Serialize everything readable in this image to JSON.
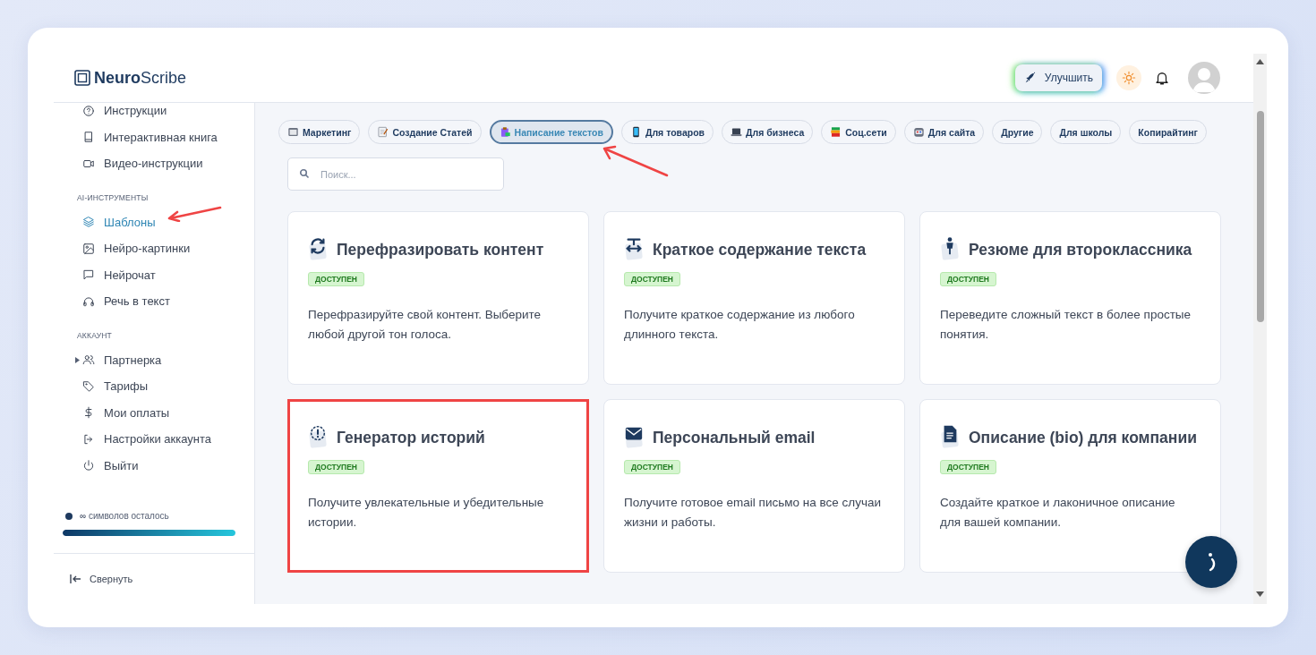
{
  "header": {
    "logo": {
      "bold": "Neuro",
      "light": "Scribe"
    },
    "upgrade_button": "Улучшить"
  },
  "sidebar": {
    "sections": [
      {
        "items": [
          {
            "label": "Инструкции",
            "kind": "help",
            "selected": false,
            "annotated": false
          },
          {
            "label": "Интерактивная книга",
            "kind": "book",
            "selected": false,
            "annotated": false
          },
          {
            "label": "Видео-инструкции",
            "kind": "video",
            "selected": false,
            "annotated": false
          }
        ]
      },
      {
        "title": "AI-ИНСТРУМЕНТЫ",
        "items": [
          {
            "label": "Шаблоны",
            "kind": "layers",
            "selected": true,
            "annotated": true
          },
          {
            "label": "Нейро-картинки",
            "kind": "image",
            "selected": false,
            "annotated": false
          },
          {
            "label": "Нейрочат",
            "kind": "chat",
            "selected": false,
            "annotated": false
          },
          {
            "label": "Речь в текст",
            "kind": "headphones",
            "selected": false,
            "annotated": false
          }
        ]
      },
      {
        "title": "АККАУНТ",
        "items": [
          {
            "label": "Партнерка",
            "kind": "users",
            "selected": false,
            "annotated": false,
            "expandable": true
          },
          {
            "label": "Тарифы",
            "kind": "tag",
            "selected": false,
            "annotated": false
          },
          {
            "label": "Мои оплаты",
            "kind": "dollar",
            "selected": false,
            "annotated": false
          },
          {
            "label": "Настройки аккаунта",
            "kind": "logout",
            "selected": false,
            "annotated": false
          },
          {
            "label": "Выйти",
            "kind": "power",
            "selected": false,
            "annotated": false
          }
        ]
      }
    ],
    "usage": {
      "text": "**∞** символов осталось",
      "level": 1
    },
    "collapse": "Свернуть"
  },
  "categories": [
    {
      "label": "Маркетинг",
      "kind": "calendar",
      "selected": false,
      "annotated": false
    },
    {
      "label": "Создание Статей",
      "kind": "memo",
      "selected": false,
      "annotated": false
    },
    {
      "label": "Написание текстов",
      "kind": "clipboard",
      "selected": true,
      "annotated": true
    },
    {
      "label": "Для товаров",
      "kind": "phone",
      "selected": false,
      "annotated": false
    },
    {
      "label": "Для бизнеса",
      "kind": "laptop",
      "selected": false,
      "annotated": false
    },
    {
      "label": "Соц.сети",
      "kind": "books",
      "selected": false,
      "annotated": false
    },
    {
      "label": "Для сайта",
      "kind": "robot",
      "selected": false,
      "annotated": false
    },
    {
      "label": "Другие",
      "selected": false,
      "annotated": false
    },
    {
      "label": "Для школы",
      "selected": false,
      "annotated": false
    },
    {
      "label": "Копирайтинг",
      "selected": false,
      "annotated": false
    }
  ],
  "search": {
    "placeholder": "Поиск..."
  },
  "templates": [
    {
      "title": "Перефразировать контент",
      "kind": "refresh",
      "badge": "ДОСТУПЕН",
      "description": "Перефразируйте свой контент. Выберите любой другой тон голоса.",
      "highlighted": false
    },
    {
      "title": "Краткое содержание текста",
      "kind": "textarrows",
      "badge": "ДОСТУПЕН",
      "description": "Получите краткое содержание из любого длинного текста.",
      "highlighted": false
    },
    {
      "title": "Резюме для второклассника",
      "kind": "child",
      "badge": "ДОСТУПЕН",
      "description": "Переведите сложный текст в более простые понятия.",
      "highlighted": false
    },
    {
      "title": "Генератор историй",
      "kind": "alert",
      "badge": "ДОСТУПЕН",
      "description": "Получите увлекательные и убедительные истории.",
      "highlighted": true
    },
    {
      "title": "Персональный email",
      "kind": "envelope",
      "badge": "ДОСТУПЕН",
      "description": "Получите готовое email письмо на все случаи жизни и работы.",
      "highlighted": false
    },
    {
      "title": "Описание (bio) для компании",
      "kind": "document",
      "badge": "ДОСТУПЕН",
      "description": "Создайте краткое и лаконичное описание для вашей компании.",
      "highlighted": false
    }
  ]
}
